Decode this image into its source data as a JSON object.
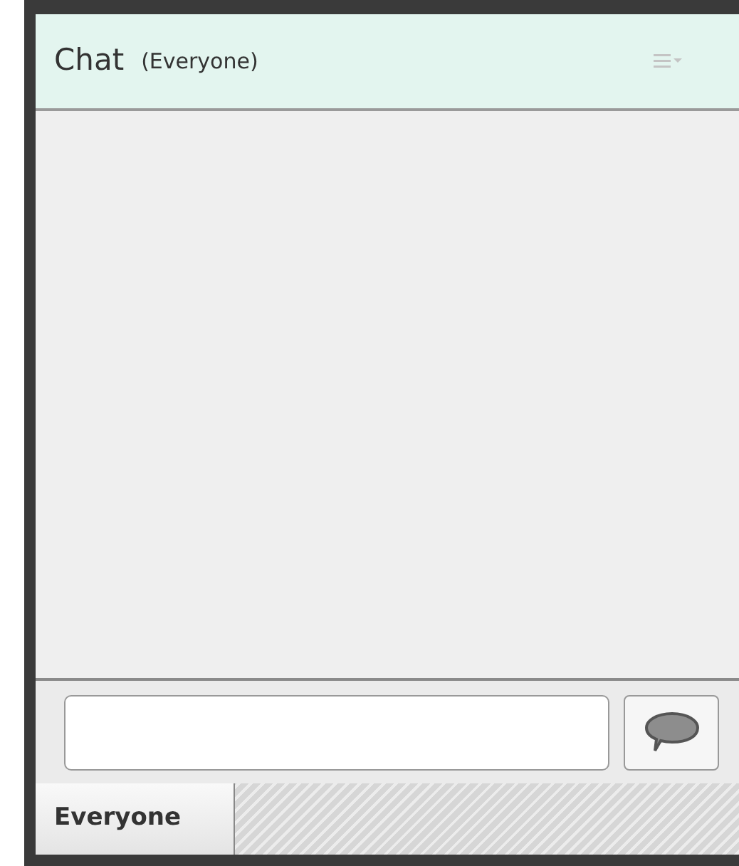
{
  "panel": {
    "title": "Chat",
    "subtitle": "(Everyone)"
  },
  "tabs": [
    {
      "label": "Everyone",
      "selected": true
    }
  ]
}
